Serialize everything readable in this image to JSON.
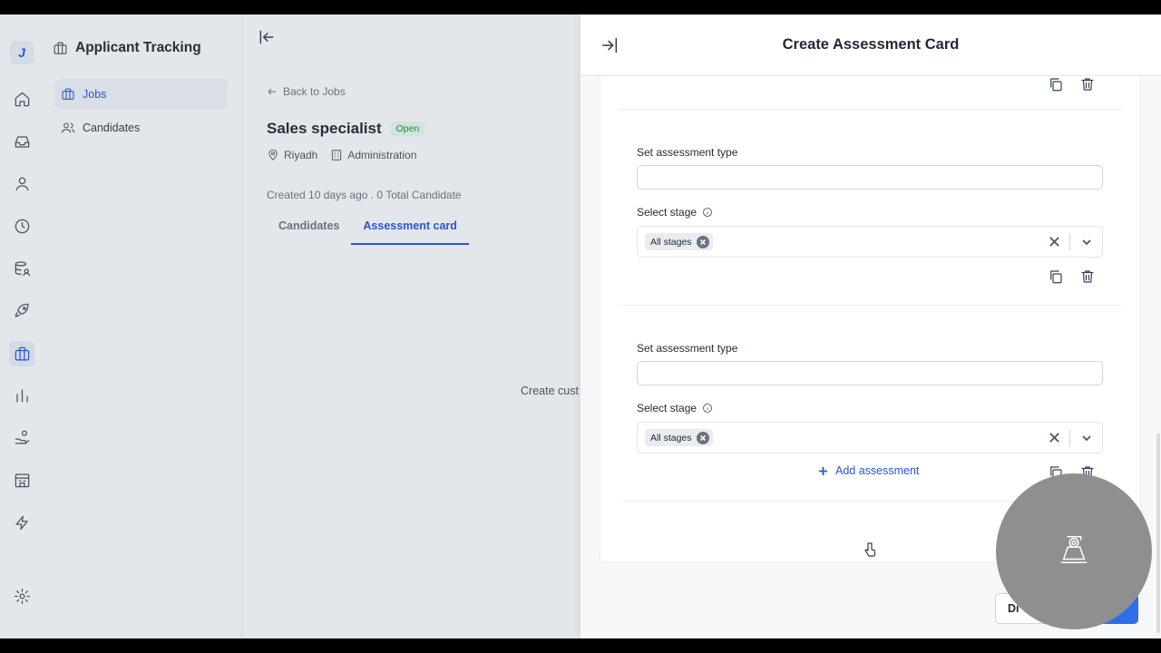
{
  "app": {
    "logo_letter": "J",
    "title": "Applicant Tracking"
  },
  "sidebar": {
    "items": [
      {
        "label": "Jobs"
      },
      {
        "label": "Candidates"
      }
    ]
  },
  "rail_icons": [
    "home-icon",
    "inbox-icon",
    "user-icon",
    "clock-icon",
    "database-user-icon",
    "rocket-icon",
    "briefcase-icon",
    "bar-chart-icon",
    "hand-coin-icon",
    "building-icon",
    "lightning-icon",
    "gear-icon"
  ],
  "job": {
    "back_label": "Back to Jobs",
    "title": "Sales specialist",
    "status": "Open",
    "location": "Riyadh",
    "department": "Administration",
    "created": "Created 10 days ago . 0 Total Candidate",
    "tabs": [
      {
        "label": "Candidates"
      },
      {
        "label": "Assessment card"
      }
    ],
    "empty_text": "Create cust"
  },
  "drawer": {
    "title": "Create Assessment Card",
    "cards": [
      {
        "type_label": "Set assessment type",
        "type_value": "",
        "stage_label": "Select stage",
        "stage_chip": "All stages"
      },
      {
        "type_label": "Set assessment type",
        "type_value": "",
        "stage_label": "Select stage",
        "stage_chip": "All stages"
      }
    ],
    "add_label": "Add assessment",
    "discard_label": "Di"
  },
  "colors": {
    "accent": "#2c57c9",
    "primary_button": "#2f6ee8",
    "open_badge_bg": "#cfe5d7",
    "open_badge_text": "#258049"
  }
}
